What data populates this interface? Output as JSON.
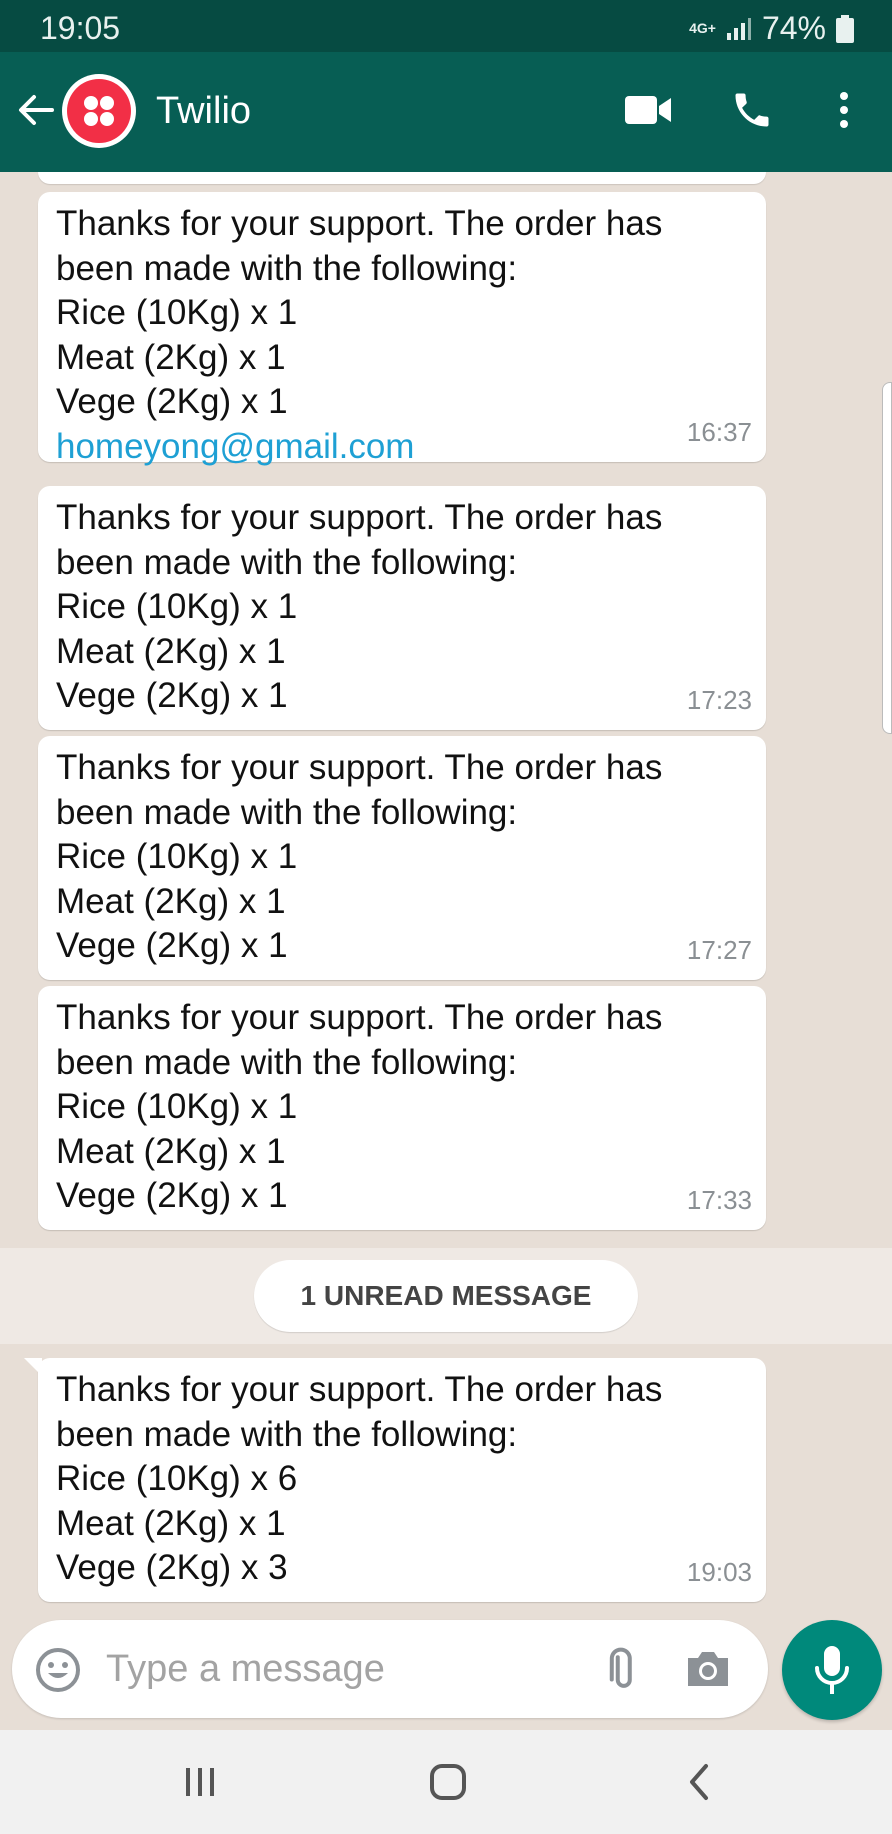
{
  "status_bar": {
    "time": "19:05",
    "network": "4G+",
    "battery": "74%"
  },
  "app_bar": {
    "contact_name": "Twilio"
  },
  "messages": [
    {
      "lines": [
        "Thanks for your support. The order has",
        "been made with the following:",
        "Rice (10Kg) x 1",
        "Meat (2Kg) x 1",
        "Vege (2Kg) x 1"
      ],
      "link": "homeyong@gmail.com",
      "time": "16:37"
    },
    {
      "lines": [
        "Thanks for your support. The order has",
        "been made with the following:",
        "Rice (10Kg) x 1",
        "Meat (2Kg) x 1",
        "Vege (2Kg) x 1"
      ],
      "time": "17:23"
    },
    {
      "lines": [
        "Thanks for your support. The order has",
        "been made with the following:",
        "Rice (10Kg) x 1",
        "Meat (2Kg) x 1",
        "Vege (2Kg) x 1"
      ],
      "time": "17:27"
    },
    {
      "lines": [
        "Thanks for your support. The order has",
        "been made with the following:",
        "Rice (10Kg) x 1",
        "Meat (2Kg) x 1",
        "Vege (2Kg) x 1"
      ],
      "time": "17:33"
    },
    {
      "lines": [
        "Thanks for your support. The order has",
        "been made with the following:",
        "Rice (10Kg) x 6",
        "Meat (2Kg) x 1",
        "Vege (2Kg) x 3"
      ],
      "time": "19:03"
    }
  ],
  "unread_label": "1 UNREAD MESSAGE",
  "composer": {
    "placeholder": "Type a message"
  },
  "icons": {
    "back": "arrow-left-icon",
    "video": "video-camera-icon",
    "call": "phone-icon",
    "menu": "more-vertical-icon",
    "emoji": "emoji-icon",
    "attach": "paperclip-icon",
    "camera": "camera-icon",
    "mic": "microphone-icon"
  },
  "colors": {
    "header": "#075e54",
    "status_bar": "#064b42",
    "accent": "#00897b",
    "link": "#1ea0d4",
    "chat_bg": "#e7ded6",
    "twilio_red": "#f22f46"
  }
}
